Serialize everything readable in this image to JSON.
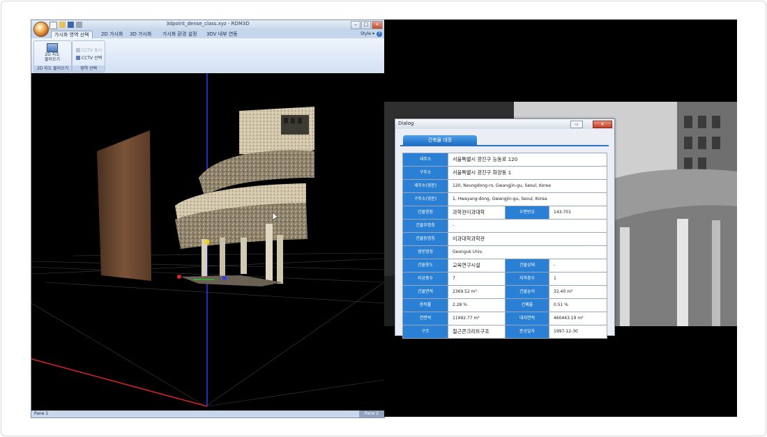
{
  "app": {
    "title": "3dpoint_dense_class.xyz - RDM3D",
    "tabs": [
      "가시화 영역 선택",
      "2D 가시화",
      "3D 가시화",
      "가시화 환경 설정",
      "3DV 내부 연동"
    ],
    "style_label": "Style",
    "help_glyph": "?",
    "ribbon": {
      "load_2d_map_line1": "2D 지도",
      "load_2d_map_line2": "불러오기",
      "group1_label": "2D 지도 불러오기",
      "cctv_view": "CCTV 표시",
      "cctv_select": "CCTV 선택",
      "group2_label": "영역 선택"
    },
    "status": {
      "pane1": "Pane 1",
      "pane2": "Pane 2"
    }
  },
  "dialog": {
    "title": "Dialog",
    "close_glyph": "x",
    "tab_label": "건축물 대장",
    "rows": {
      "road_address": {
        "label": "새주소",
        "value": "서울특별시 광진구 능동로 120"
      },
      "old_address": {
        "label": "구주소",
        "value": "서울특별시 광진구 화양동 1"
      },
      "road_address_en": {
        "label": "새주소(영문)",
        "value": "120, Neungdong-ro, Gwangjin-gu, Seoul, Korea"
      },
      "old_address_en": {
        "label": "구주소(영문)",
        "value": "1, Hwayang-dong, Gwangjin-gu, Seoul, Korea"
      },
      "building_name": {
        "label": "건물명칭",
        "value": "과학관이과대학"
      },
      "postal_code": {
        "label": "우편번호",
        "value": "143-701"
      },
      "sub_name": {
        "label": "건물부명칭",
        "value": "-"
      },
      "dong_name": {
        "label": "건물동명칭",
        "value": "이과대학과학관"
      },
      "english_name": {
        "label": "영문명칭",
        "value": "Geonguk Univ."
      },
      "usage": {
        "label": "건물용도",
        "value": "교육연구시설"
      },
      "status": {
        "label": "건물상태",
        "value": "-"
      },
      "floors_above": {
        "label": "지상층수",
        "value": "7"
      },
      "floors_below": {
        "label": "지하층수",
        "value": "1"
      },
      "building_area": {
        "label": "건물면적",
        "value": "2369.52 m²"
      },
      "height": {
        "label": "건물높이",
        "value": "32.40 m²"
      },
      "floor_area_ratio": {
        "label": "용적률",
        "value": "2.28 %"
      },
      "coverage_ratio": {
        "label": "건폐율",
        "value": "0.51 %"
      },
      "total_floor_area": {
        "label": "연면적",
        "value": "11992.77 m²"
      },
      "site_area": {
        "label": "대지면적",
        "value": "460443.19 m²"
      },
      "structure": {
        "label": "구조",
        "value": "철근콘크리트구조"
      },
      "completion_date": {
        "label": "준공일자",
        "value": "1997-12-30"
      }
    }
  },
  "colors": {
    "header_blue": "#2a80d4",
    "tab_blue": "#1f6fc4",
    "axis_blue": "#2a3cff",
    "axis_red": "#e22222"
  }
}
